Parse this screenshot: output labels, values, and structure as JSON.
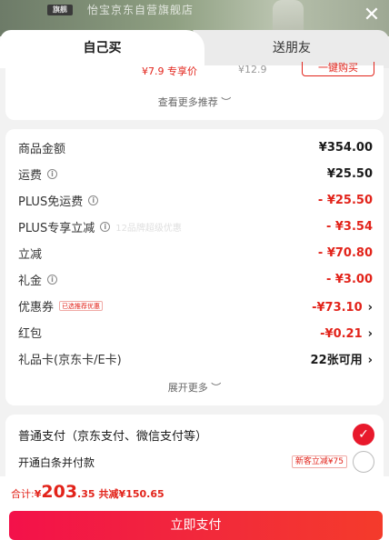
{
  "background": {
    "store_tag": "旗舰",
    "store_name": "怡宝京东自营旗舰店"
  },
  "tabs": {
    "self": "自己买",
    "friend": "送朋友"
  },
  "recommend": {
    "price": "¥7.9 专享价",
    "orig_price": "¥12.9",
    "buy_label": "一键购买",
    "more_label": "查看更多推荐 ︶"
  },
  "price_detail": {
    "rows": [
      {
        "label": "商品金额",
        "value": "¥354.00"
      },
      {
        "label": "运费",
        "value": "¥25.50"
      },
      {
        "label": "PLUS免运费",
        "value": "- ¥25.50"
      },
      {
        "label": "PLUS专享立减",
        "value": "- ¥3.54",
        "note": "12品牌超级优惠"
      },
      {
        "label": "立减",
        "value": "- ¥70.80"
      },
      {
        "label": "礼金",
        "value": "- ¥3.00"
      },
      {
        "label": "优惠券",
        "value": "-¥73.10",
        "badge": "已选推荐优惠"
      },
      {
        "label": "红包",
        "value": "-¥0.21"
      },
      {
        "label": "礼品卡(京东卡/E卡)",
        "value": "22张可用"
      }
    ],
    "expand_label": "展开更多 ︶"
  },
  "payment": {
    "primary": "普通支付（京东支付、微信支付等）",
    "baitiao": "开通白条并付款",
    "baitiao_badge": "新客立减¥75"
  },
  "total": {
    "label": "合计:",
    "currency": "¥",
    "integer": "203",
    "decimal": ".35",
    "saved": "共减¥150.65"
  },
  "pay_button": "立即支付",
  "colors": {
    "accent": "#e2231a",
    "button_start": "#f3114a",
    "button_end": "#f43b2b"
  }
}
